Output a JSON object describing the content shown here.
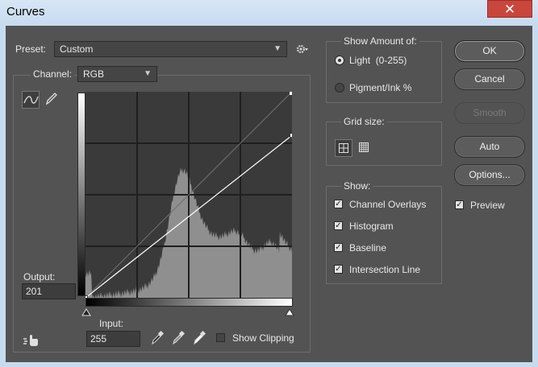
{
  "window": {
    "title": "Curves",
    "close_glyph": "✕"
  },
  "preset": {
    "label": "Preset:",
    "value": "Custom"
  },
  "channel": {
    "label": "Channel:",
    "value": "RGB"
  },
  "output": {
    "label": "Output:",
    "value": "201"
  },
  "input": {
    "label": "Input:",
    "value": "255"
  },
  "show_clipping": {
    "label": "Show Clipping",
    "checked": false
  },
  "curve": {
    "points": [
      {
        "input": 0,
        "output": 0
      },
      {
        "input": 255,
        "output": 201
      }
    ]
  },
  "show_amount": {
    "title": "Show Amount of:",
    "options": [
      {
        "label": "Light  (0-255)",
        "selected": true
      },
      {
        "label": "Pigment/Ink %",
        "selected": false
      }
    ]
  },
  "grid_size": {
    "title": "Grid size:"
  },
  "show": {
    "title": "Show:",
    "options": [
      {
        "label": "Channel Overlays",
        "checked": true
      },
      {
        "label": "Histogram",
        "checked": true
      },
      {
        "label": "Baseline",
        "checked": true
      },
      {
        "label": "Intersection Line",
        "checked": true
      }
    ]
  },
  "buttons": {
    "ok": "OK",
    "cancel": "Cancel",
    "smooth": "Smooth",
    "auto": "Auto",
    "options": "Options..."
  },
  "preview": {
    "label": "Preview",
    "checked": true
  },
  "check_glyph": "✓",
  "icons": [
    "close-icon",
    "gear-icon",
    "chevron-down-icon",
    "curve-point-tool-icon",
    "pencil-icon",
    "grid-simple-icon",
    "grid-detailed-icon",
    "black-eyedropper-icon",
    "gray-eyedropper-icon",
    "white-eyedropper-icon",
    "on-image-adjust-icon",
    "slider-triangle-icon"
  ],
  "colors": {
    "panel": "#535353",
    "graph_bg": "#3a3a3a",
    "histogram": "#8f8f8f",
    "title_bar": "#cfe0f2",
    "close": "#c9463d"
  }
}
